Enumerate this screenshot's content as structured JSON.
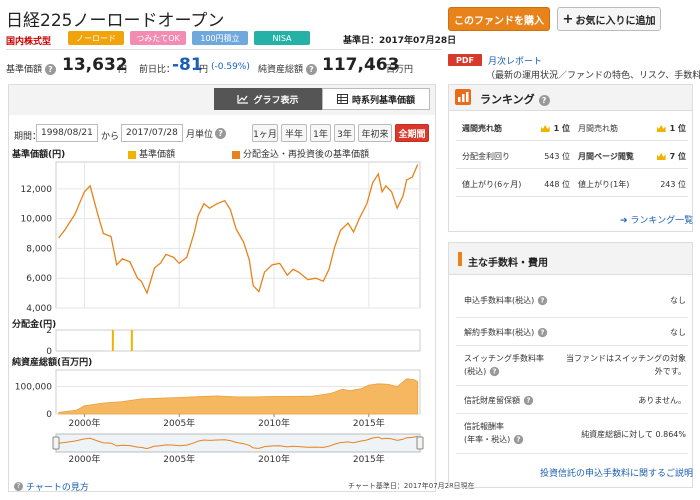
{
  "fund": {
    "title": "日経225ノーロードオープン",
    "category": "国内株式型",
    "badges": [
      {
        "label": "ノーロード",
        "color": "#f0a30a"
      },
      {
        "label": "つみたてOK",
        "color": "#f28cb1"
      },
      {
        "label": "100円積立",
        "color": "#6fa8dc"
      },
      {
        "label": "NISA",
        "color": "#25b1a5"
      }
    ],
    "base_date": "基準日：2017年07月28日"
  },
  "actions": {
    "buy_label": "このファンドを購入",
    "fav_label": "お気に入りに追加",
    "fav_plus": "+"
  },
  "stats": {
    "nav_label": "基準価額",
    "nav_value": "13,632",
    "nav_unit": "円",
    "change_label": "前日比：",
    "change_value": "-81",
    "change_unit": "円",
    "change_pct": "(-0.59%)",
    "assets_label": "純資産総額",
    "assets_value": "117,463",
    "assets_unit": "百万円"
  },
  "report": {
    "pdf_label": "PDF",
    "link_label": "月次レポート",
    "desc": "（最新の運用状況／ファンドの特色、リスク、手数料等）"
  },
  "chart_controls": {
    "tab_graph": "グラフ表示",
    "tab_series": "時系列基準価額",
    "period_label": "期間：",
    "from_date": "1998/08/21",
    "to_label": "から",
    "to_date": "2017/07/28",
    "unit_label": "月単位",
    "ranges": [
      "1ヶ月",
      "半年",
      "1年",
      "3年",
      "年初来",
      "全期間"
    ],
    "active_range": "全期間"
  },
  "chart_labels": {
    "nav_section": "基準価額(円)",
    "legend_nav": "基準価額",
    "legend_reinvest": "分配金込・再投資後の基準価額",
    "dist_section": "分配金(円)",
    "assets_section": "純資産総額(百万円)",
    "chart_note": "チャート基準日：2017年07月28日現在",
    "howto": "チャートの見方",
    "howto_icon": "?"
  },
  "chart_data": [
    {
      "type": "line",
      "name": "nav",
      "series": [
        {
          "name": "分配金込・再投資後の基準価額",
          "color": "#e8821b"
        }
      ],
      "x": [
        1998.64,
        1999.0,
        1999.5,
        2000.0,
        2000.3,
        2000.7,
        2001.0,
        2001.4,
        2001.7,
        2002.0,
        2002.4,
        2002.8,
        2003.0,
        2003.3,
        2003.7,
        2004.0,
        2004.3,
        2004.7,
        2005.0,
        2005.4,
        2005.8,
        2006.0,
        2006.3,
        2006.6,
        2007.0,
        2007.4,
        2007.7,
        2008.0,
        2008.4,
        2008.7,
        2008.9,
        2009.2,
        2009.5,
        2009.9,
        2010.3,
        2010.7,
        2011.0,
        2011.3,
        2011.8,
        2012.2,
        2012.6,
        2012.9,
        2013.2,
        2013.5,
        2013.9,
        2014.2,
        2014.5,
        2014.9,
        2015.2,
        2015.5,
        2015.7,
        2015.9,
        2016.2,
        2016.5,
        2016.8,
        2017.0,
        2017.3,
        2017.58
      ],
      "y": [
        8700,
        9300,
        10300,
        11800,
        12200,
        10300,
        9000,
        8800,
        6900,
        7300,
        7100,
        6000,
        5800,
        5000,
        6700,
        7000,
        7600,
        7400,
        7000,
        7400,
        9100,
        10200,
        11000,
        10700,
        11000,
        11200,
        10600,
        9300,
        8400,
        7200,
        5500,
        5100,
        6400,
        6900,
        7000,
        6200,
        6600,
        6400,
        5900,
        6000,
        5800,
        6600,
        8100,
        9200,
        9700,
        9100,
        10000,
        11000,
        12400,
        13000,
        11800,
        12200,
        11800,
        10700,
        11500,
        12600,
        12800,
        13632
      ],
      "ylim": [
        4000,
        13800
      ],
      "yticks": [
        4000,
        6000,
        8000,
        10000,
        12000
      ],
      "ytick_labels": [
        "4,000",
        "6,000",
        "8,000",
        "10,000",
        "12,000"
      ],
      "xlim": [
        1998.5,
        2017.7
      ],
      "grid": true,
      "legend": [
        {
          "label": "基準価額",
          "color": "#f0b400"
        },
        {
          "label": "分配金込・再投資後の基準価額",
          "color": "#e8821b"
        }
      ],
      "legend_placement": "top"
    },
    {
      "type": "bar",
      "name": "distribution",
      "x": [
        2001.5,
        2002.5
      ],
      "values": [
        2,
        2
      ],
      "color": "#f0b400",
      "ylim": [
        0,
        2
      ],
      "yticks": [
        0,
        2
      ],
      "ytick_labels": [
        "0",
        "2"
      ]
    },
    {
      "type": "area",
      "name": "net_assets",
      "color": "#f5b860",
      "x": [
        1998.64,
        1999.0,
        1999.6,
        2000.0,
        2000.6,
        2001.0,
        2002.0,
        2003.0,
        2004.0,
        2005.0,
        2006.0,
        2007.0,
        2008.0,
        2009.0,
        2010.0,
        2011.0,
        2012.0,
        2013.0,
        2013.6,
        2014.0,
        2014.6,
        2015.0,
        2015.5,
        2016.0,
        2016.5,
        2017.0,
        2017.4,
        2017.58
      ],
      "y": [
        6000,
        9000,
        14000,
        30000,
        36000,
        40000,
        45000,
        55000,
        58000,
        60000,
        63000,
        66000,
        62000,
        62000,
        64000,
        64000,
        65000,
        75000,
        90000,
        85000,
        92000,
        105000,
        110000,
        108000,
        100000,
        128000,
        125000,
        117463
      ],
      "ylim": [
        0,
        160000
      ],
      "yticks": [
        0,
        100000
      ],
      "ytick_labels": [
        "0",
        "100,000"
      ]
    },
    {
      "type": "line",
      "name": "navigator",
      "color": "#e8821b",
      "xticks": [
        2000,
        2005,
        2010,
        2015
      ],
      "xtick_labels": [
        "2000年",
        "2005年",
        "2010年",
        "2015年"
      ]
    }
  ],
  "ranking": {
    "title": "ランキング",
    "rows": [
      [
        {
          "label": "週間売れ筋",
          "val": "1 位",
          "crown": true,
          "bold": true
        },
        {
          "label": "月間売れ筋",
          "val": "1 位",
          "crown": true,
          "bold": false
        }
      ],
      [
        {
          "label": "分配金利回り",
          "val": "543 位",
          "crown": false,
          "bold": false
        },
        {
          "label": "月間ページ閲覧",
          "val": "7 位",
          "crown": true,
          "bold": true
        }
      ],
      [
        {
          "label": "値上がり(6ヶ月)",
          "val": "448 位",
          "crown": false,
          "bold": false
        },
        {
          "label": "値上がり(1年)",
          "val": "243 位",
          "crown": false,
          "bold": false
        }
      ]
    ],
    "link": "ランキング一覧"
  },
  "fees": {
    "title": "主な手数料・費用",
    "rows": [
      {
        "label": "申込手数料率(税込)",
        "val": "なし"
      },
      {
        "label": "解約手数料率(税込)",
        "val": "なし"
      },
      {
        "label": "スイッチング手数料率\n(税込)",
        "val": "当ファンドはスイッチングの対象\n外です。"
      },
      {
        "label": "信託財産留保額",
        "val": "ありません。"
      },
      {
        "label": "信託報酬率\n(年率・税込)",
        "val": "純資産総額に対して 0.864%"
      }
    ],
    "link": "投資信託の申込手数料に関するご説明"
  }
}
